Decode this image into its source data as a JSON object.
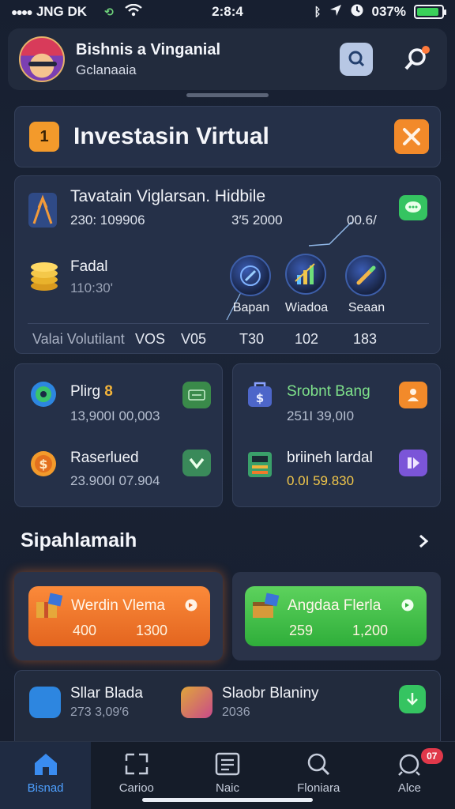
{
  "status_bar": {
    "carrier": "JNG DK",
    "time": "2:8:4",
    "battery": "037%",
    "battery_level": 0.9
  },
  "header": {
    "title": "Bishnis a Vinganial",
    "subtitle": "Gclanaaia",
    "icons": [
      "avatar",
      "search-icon",
      "notification-icon"
    ]
  },
  "banner": {
    "number": "1",
    "title": "Investasin Virtual",
    "accent": "#f39a2b"
  },
  "portfolio": {
    "title": "Tavatain Viglarsan. Hidbile",
    "value1": "230: 109906",
    "value2": "3′5 2000",
    "value3": "00.6/",
    "fund_label": "Fadal",
    "fund_value": "110:30'",
    "items": [
      {
        "label": "Bapan",
        "icon": "compass-icon"
      },
      {
        "label": "Wiadoa",
        "icon": "chart-growth-icon"
      },
      {
        "label": "Seaan",
        "icon": "pencil-icon"
      }
    ],
    "volume_label": "Valai Volutilant",
    "volume_values": [
      "VOS",
      "V05",
      "T30",
      "102",
      "183"
    ]
  },
  "cards": {
    "left": [
      {
        "label": "Plirg",
        "value": "13,900I 00,003",
        "badge": "8"
      },
      {
        "label": "Raserlued",
        "value": "23.900I 07.904"
      }
    ],
    "right": [
      {
        "label": "Srobnt Bang",
        "value": "251I 39,0I0"
      },
      {
        "label": "briineh lardal",
        "value": "0.0I 59.830"
      }
    ]
  },
  "section": {
    "title": "Sipahlamaih"
  },
  "promos": [
    {
      "title": "Werdin Vlema",
      "a": "400",
      "b": "1300",
      "color": "#f07a2b"
    },
    {
      "title": "Angdaa Flerla",
      "a": "259",
      "b": "1,200",
      "color": "#45c24c"
    }
  ],
  "bottom_items": [
    {
      "label": "Sllar Blada",
      "value": "273 3,09′6"
    },
    {
      "label": "Slaobr Blaniny",
      "value": "2036"
    }
  ],
  "tabbar": {
    "tabs": [
      {
        "label": "Bisnad",
        "icon": "home-icon",
        "active": true
      },
      {
        "label": "Carioo",
        "icon": "cart-icon"
      },
      {
        "label": "Naic",
        "icon": "list-icon"
      },
      {
        "label": "Floniara",
        "icon": "search-icon"
      },
      {
        "label": "Alce",
        "icon": "alert-icon",
        "badge": "07"
      }
    ]
  }
}
